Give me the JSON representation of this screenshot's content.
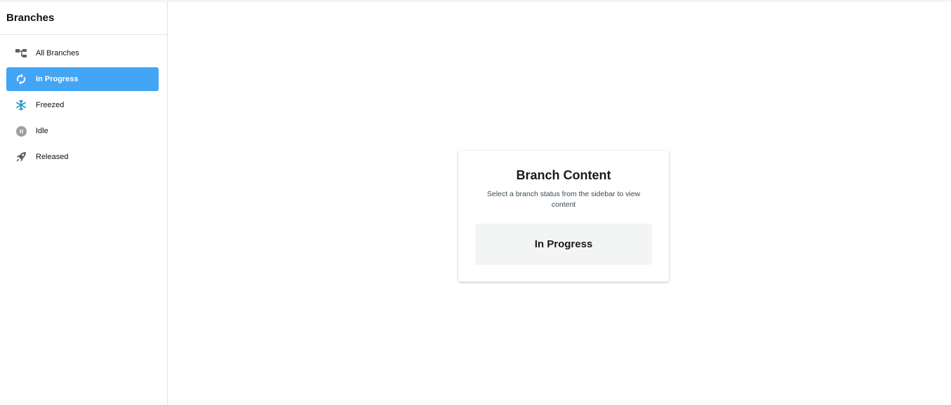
{
  "sidebar": {
    "title": "Branches",
    "items": [
      {
        "label": "All Branches",
        "icon": "branches-icon",
        "active": false
      },
      {
        "label": "In Progress",
        "icon": "sync-icon",
        "active": true
      },
      {
        "label": "Freezed",
        "icon": "snowflake-icon",
        "active": false
      },
      {
        "label": "Idle",
        "icon": "pause-circle-icon",
        "active": false
      },
      {
        "label": "Released",
        "icon": "rocket-icon",
        "active": false
      }
    ]
  },
  "main": {
    "card": {
      "title": "Branch Content",
      "subtitle": "Select a branch status from the sidebar to view content",
      "selected_status": "In Progress"
    }
  },
  "colors": {
    "accent": "#42a5f5",
    "snowflake": "#2196c9",
    "icon_gray": "#5f6368",
    "idle_gray": "#9e9e9e",
    "status_box_bg": "#f3f4f4"
  }
}
